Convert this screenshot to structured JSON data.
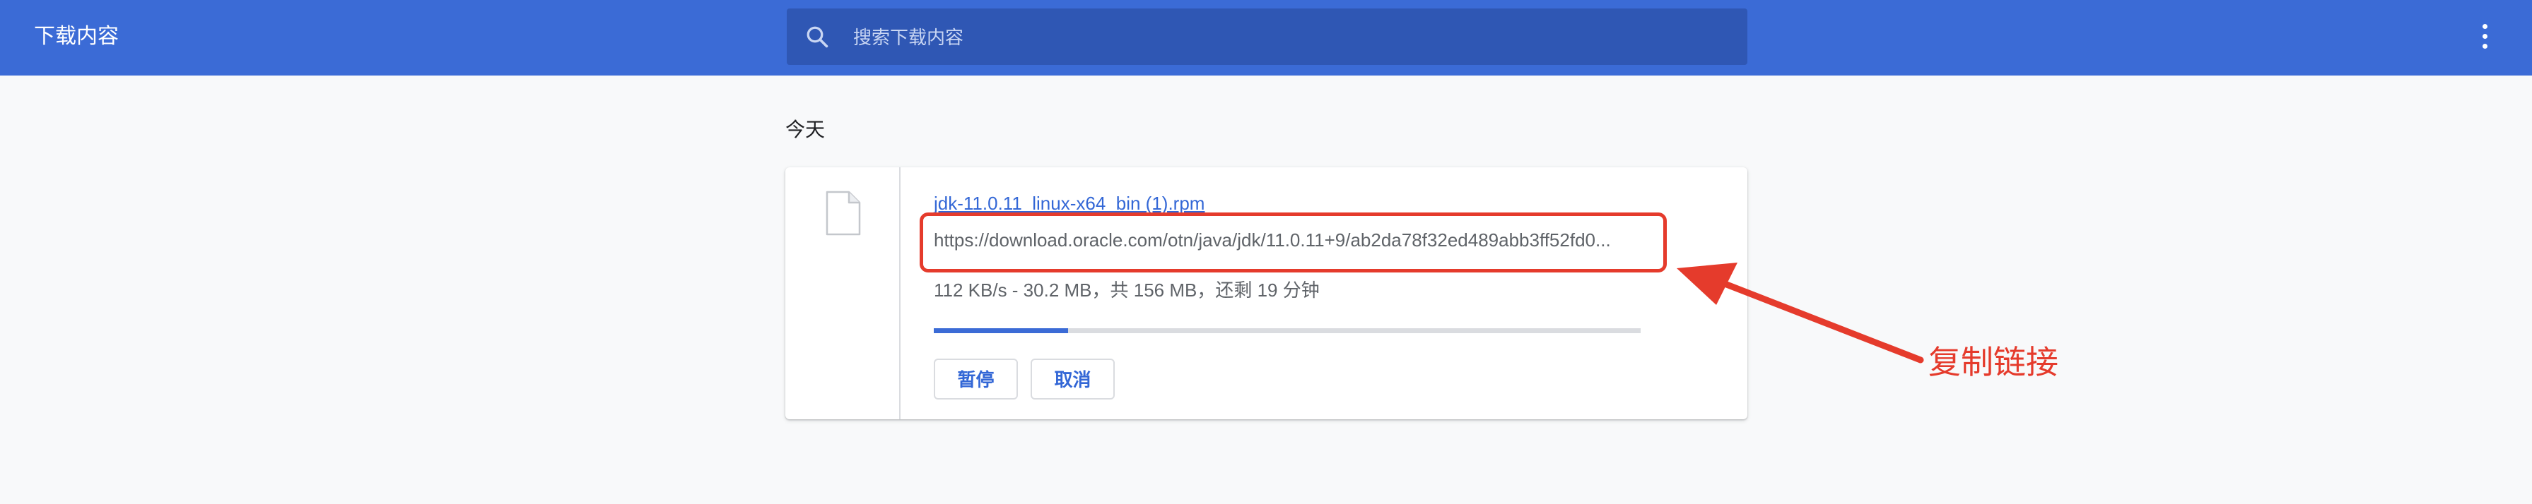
{
  "header": {
    "title": "下载内容",
    "search_placeholder": "搜索下载内容",
    "search_value": "",
    "search_icon": "search-icon",
    "menu_icon": "more-vertical-icon",
    "background_color": "#3b6bd6"
  },
  "section": {
    "label": "今天"
  },
  "download": {
    "file_icon": "file-icon",
    "file_name": "jdk-11.0.11_linux-x64_bin (1).rpm",
    "url": "https://download.oracle.com/otn/java/jdk/11.0.11+9/ab2da78f32ed489abb3ff52fd0...",
    "status": "112 KB/s - 30.2 MB，共 156 MB，还剩 19 分钟",
    "progress_fraction": 0.19,
    "pause_label": "暂停",
    "cancel_label": "取消",
    "accent_color": "#3367d6"
  },
  "annotation": {
    "text": "复制链接",
    "color": "#e53b2c"
  }
}
